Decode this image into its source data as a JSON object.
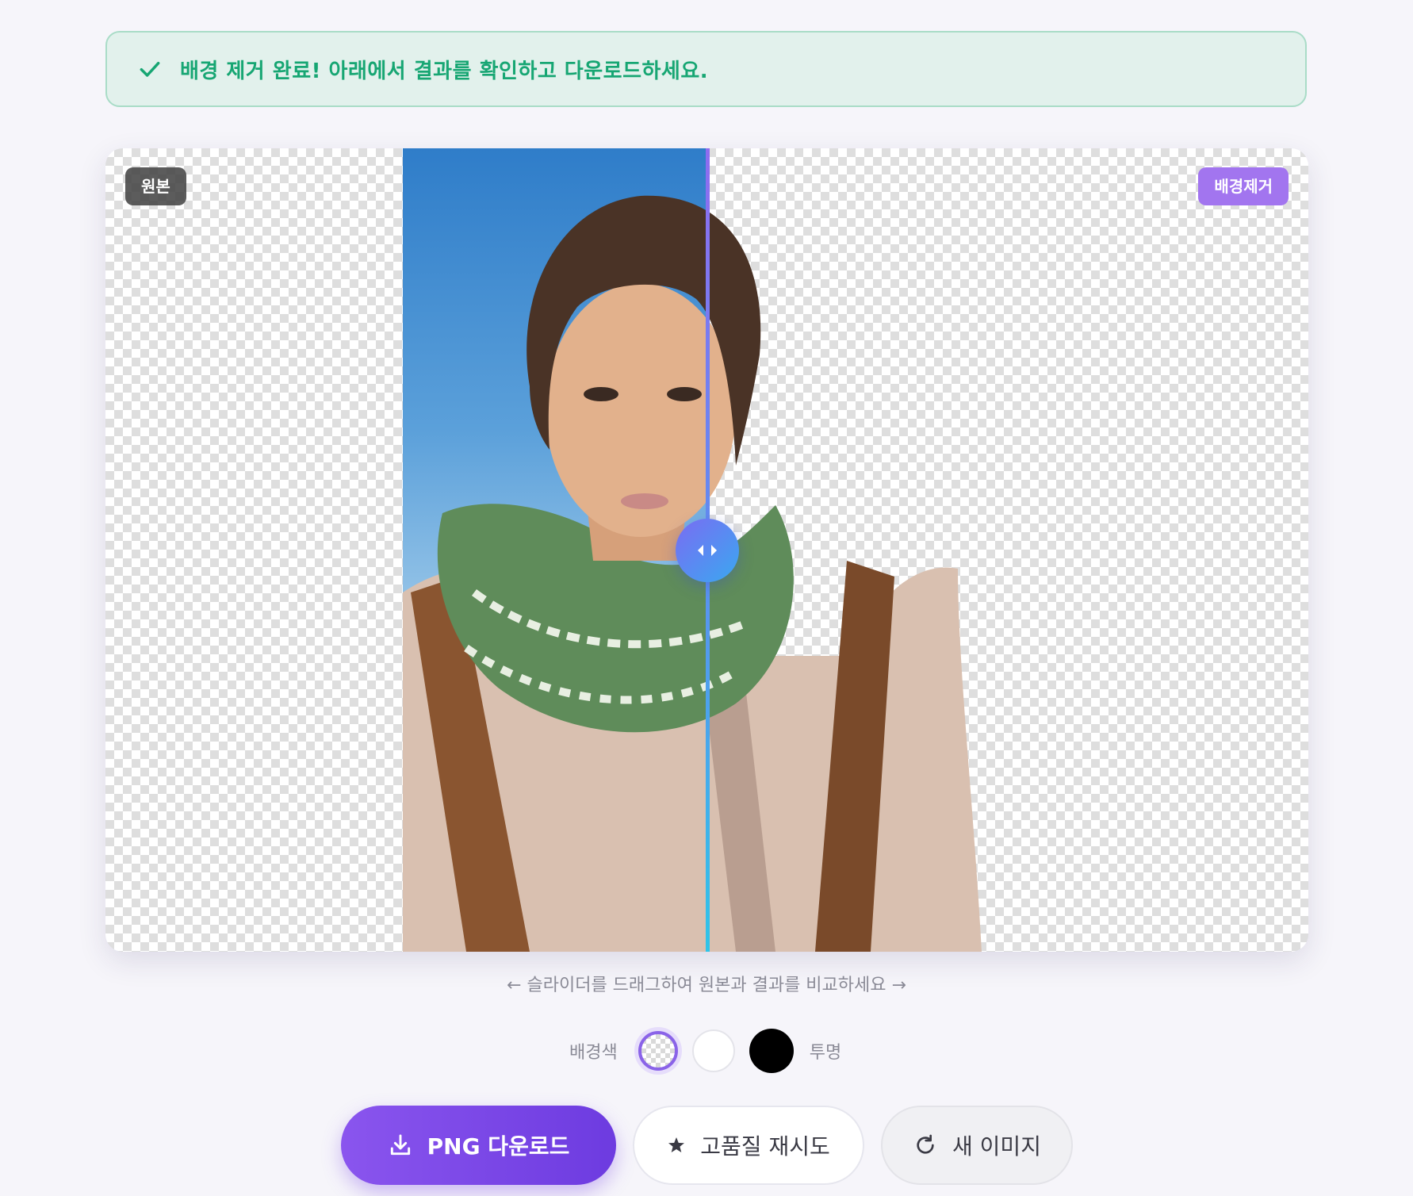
{
  "banner": {
    "icon": "check-icon",
    "message": "배경 제거 완료! 아래에서 결과를 확인하고 다운로드하세요.",
    "color": "#17a673"
  },
  "comparison": {
    "original_label": "원본",
    "result_label": "배경제거",
    "slider_position": 0.5,
    "handle_icon": "arrows-left-right-icon"
  },
  "hint": "← 슬라이더를 드래그하여 원본과 결과를 비교하세요 →",
  "background_color": {
    "label": "배경색",
    "options": [
      "transparent",
      "white",
      "black"
    ],
    "selected": "transparent",
    "selected_label": "투명",
    "accent": "#8a63e8"
  },
  "actions": {
    "download_label": "PNG 다운로드",
    "download_icon": "download-icon",
    "retry_label": "고품질 재시도",
    "retry_icon": "star-icon",
    "new_label": "새 이미지",
    "new_icon": "refresh-icon",
    "primary_color": "#7c48e8"
  }
}
